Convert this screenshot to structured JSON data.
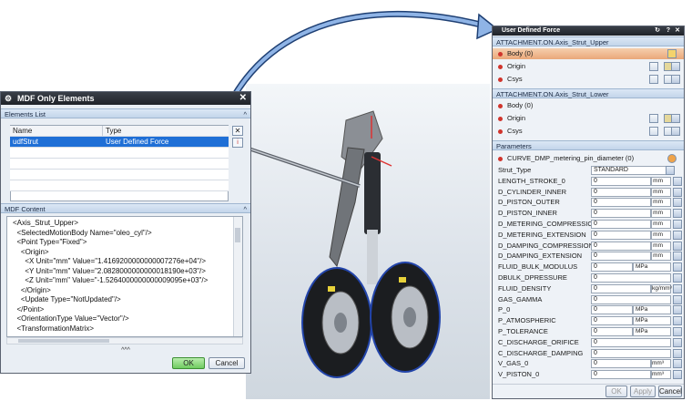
{
  "mdf_dialog": {
    "title": "MDF Only Elements",
    "elements_section": "Elements List",
    "columns": [
      "Name",
      "Type"
    ],
    "rows": [
      {
        "name": "udfStrut",
        "type": "User Defined Force"
      }
    ],
    "content_section": "MDF Content",
    "xml_lines": [
      "<Axis_Strut_Upper>",
      "  <SelectedMotionBody Name=\"oleo_cyl\"/>",
      "  <Point Type=\"Fixed\">",
      "    <Origin>",
      "      <X Unit=\"mm\" Value=\"1.4169200000000007276e+04\"/>",
      "      <Y Unit=\"mm\" Value=\"2.0828000000000018190e+03\"/>",
      "      <Z Unit=\"mm\" Value=\"-1.5264000000000009095e+03\"/>",
      "    </Origin>",
      "    <Update Type=\"NotUpdated\"/>",
      "  </Point>",
      "  <OrientationType Value=\"Vector\"/>",
      "  <TransformationMatrix>"
    ],
    "expand_glyph": "^^^",
    "ok_label": "OK",
    "cancel_label": "Cancel"
  },
  "udf_dialog": {
    "title": "User Defined Force",
    "upper_section": "ATTACHMENT.ON.Axis_Strut_Upper",
    "upper_rows": [
      "Body (0)",
      "Origin",
      "Csys"
    ],
    "lower_section": "ATTACHMENT.ON.Axis_Strut_Lower",
    "lower_rows": [
      "Body (0)",
      "Origin",
      "Csys"
    ],
    "params_section": "Parameters",
    "curve_label": "CURVE_DMP_metering_pin_diameter (0)",
    "params": [
      {
        "label": "Strut_Type",
        "value": "STANDARD",
        "unit": ""
      },
      {
        "label": "LENGTH_STROKE_0",
        "value": "0",
        "unit": "mm"
      },
      {
        "label": "D_CYLINDER_INNER",
        "value": "0",
        "unit": "mm"
      },
      {
        "label": "D_PISTON_OUTER",
        "value": "0",
        "unit": "mm"
      },
      {
        "label": "D_PISTON_INNER",
        "value": "0",
        "unit": "mm"
      },
      {
        "label": "D_METERING_COMPRESSION",
        "value": "0",
        "unit": "mm"
      },
      {
        "label": "D_METERING_EXTENSION",
        "value": "0",
        "unit": "mm"
      },
      {
        "label": "D_DAMPING_COMPRESSION",
        "value": "0",
        "unit": "mm"
      },
      {
        "label": "D_DAMPING_EXTENSION",
        "value": "0",
        "unit": "mm"
      },
      {
        "label": "FLUID_BULK_MODULUS",
        "value": "0",
        "unit": "MPa"
      },
      {
        "label": "DBULK_DPRESSURE",
        "value": "0",
        "unit": ""
      },
      {
        "label": "FLUID_DENSITY",
        "value": "0",
        "unit": "kg/mm³"
      },
      {
        "label": "GAS_GAMMA",
        "value": "0",
        "unit": ""
      },
      {
        "label": "P_0",
        "value": "0",
        "unit": "MPa"
      },
      {
        "label": "P_ATMOSPHERIC",
        "value": "0",
        "unit": "MPa"
      },
      {
        "label": "P_TOLERANCE",
        "value": "0",
        "unit": "MPa"
      },
      {
        "label": "C_DISCHARGE_ORIFICE",
        "value": "0",
        "unit": ""
      },
      {
        "label": "C_DISCHARGE_DAMPING",
        "value": "0",
        "unit": ""
      },
      {
        "label": "V_GAS_0",
        "value": "0",
        "unit": "mm³"
      },
      {
        "label": "V_PISTON_0",
        "value": "0",
        "unit": "mm³"
      }
    ],
    "ok_label": "OK",
    "apply_label": "Apply",
    "cancel_label": "Cancel"
  },
  "colors": {
    "accent_selection": "#1f6fd6",
    "highlight_row": "#f0b98f",
    "required_dot": "#d0342c",
    "ok_green": "#7ad36b"
  }
}
